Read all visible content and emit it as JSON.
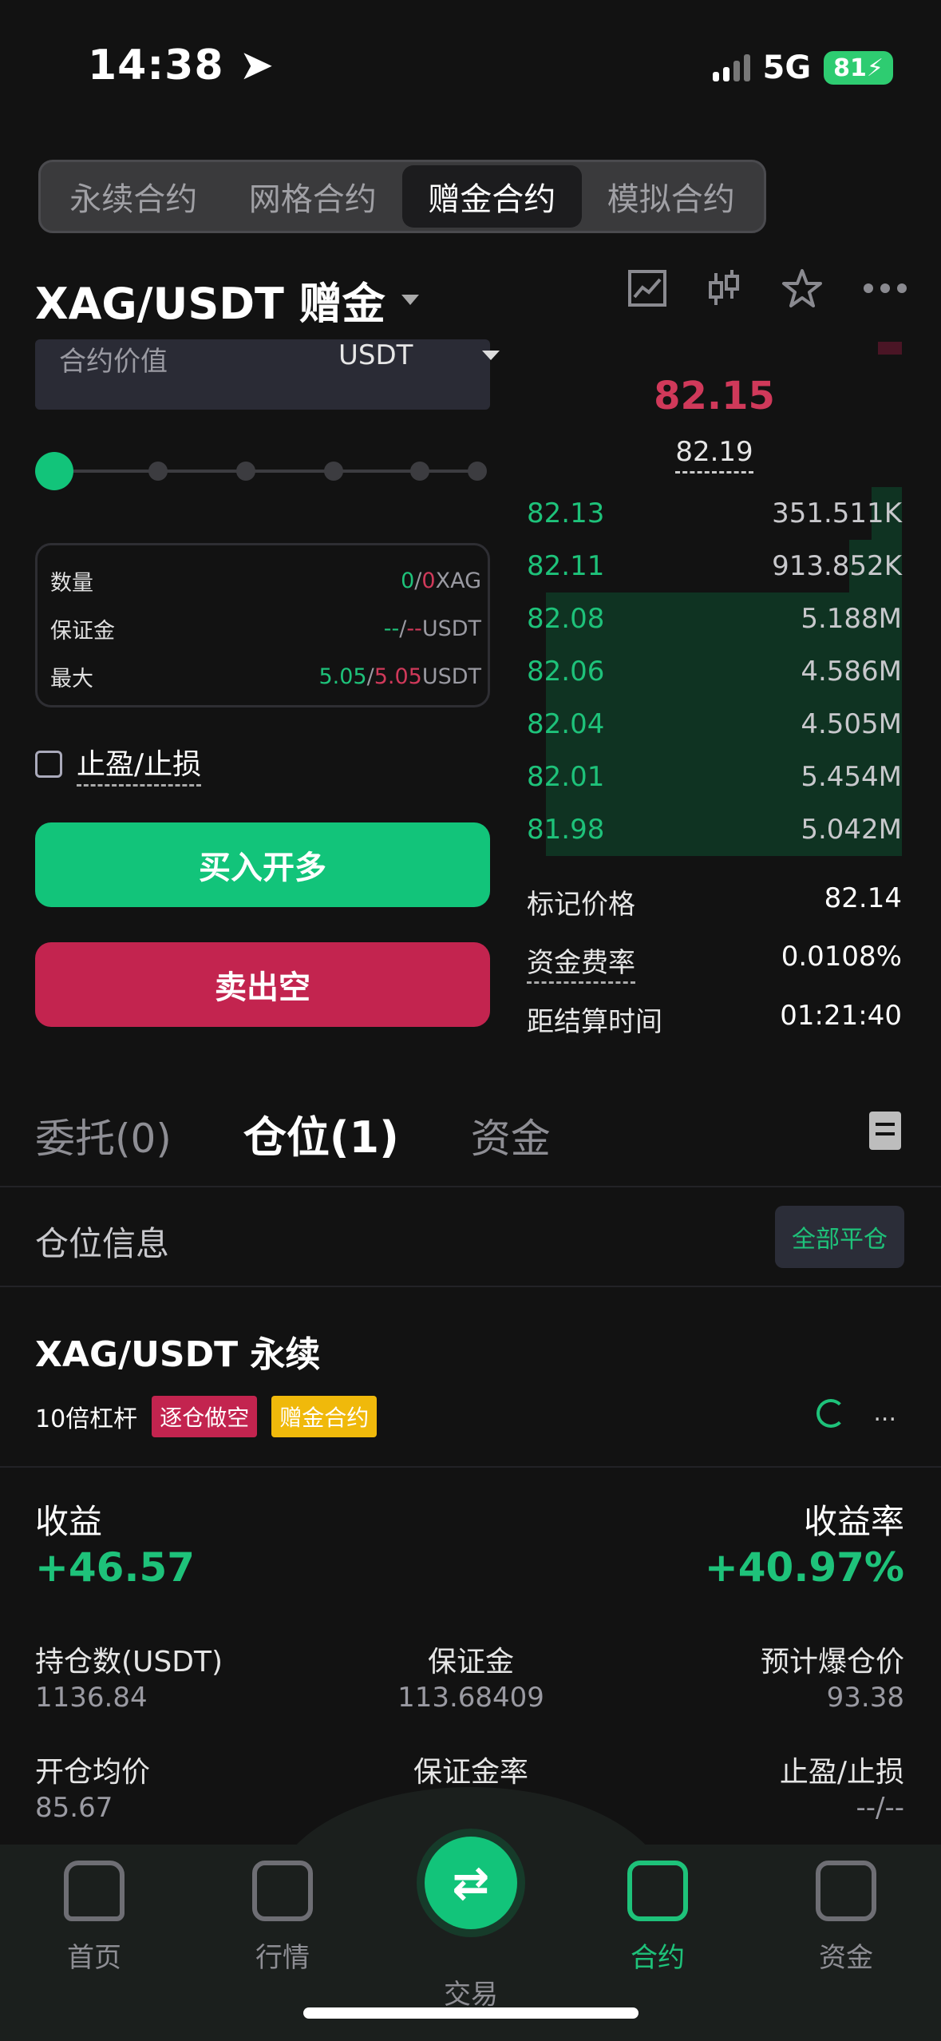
{
  "status": {
    "time": "14:38",
    "network": "5G",
    "battery": "81"
  },
  "segment_tabs": [
    "永续合约",
    "网格合约",
    "赠金合约",
    "模拟合约"
  ],
  "pair": {
    "title": "XAG/USDT 赠金"
  },
  "order": {
    "value_label": "合约价值",
    "unit": "USDT",
    "qty_label": "数量",
    "qty_v1": "0",
    "qty_v2": "0",
    "qty_unit": "XAG",
    "margin_label": "保证金",
    "margin_v1": "--",
    "margin_v2": "--",
    "margin_unit": "USDT",
    "max_label": "最大",
    "max_v1": "5.05",
    "max_v2": "5.05",
    "max_unit": "USDT",
    "tp_sl": "止盈/止损",
    "buy": "买入开多",
    "sell": "卖出空"
  },
  "orderbook": {
    "last_price": "82.15",
    "mark_small": "82.19",
    "bids": [
      {
        "price": "82.13",
        "qty": "351.511K",
        "depth": 0.08
      },
      {
        "price": "82.11",
        "qty": "913.852K",
        "depth": 0.14
      },
      {
        "price": "82.08",
        "qty": "5.188M",
        "depth": 0.95
      },
      {
        "price": "82.06",
        "qty": "4.586M",
        "depth": 0.95
      },
      {
        "price": "82.04",
        "qty": "4.505M",
        "depth": 0.95
      },
      {
        "price": "82.01",
        "qty": "5.454M",
        "depth": 0.95
      },
      {
        "price": "81.98",
        "qty": "5.042M",
        "depth": 0.95
      }
    ],
    "mark_label": "标记价格",
    "mark_value": "82.14",
    "funding_label": "资金费率",
    "funding_value": "0.0108%",
    "settle_label": "距结算时间",
    "settle_value": "01:21:40"
  },
  "tabs": {
    "orders": "委托(0)",
    "positions": "仓位(1)",
    "funds": "资金"
  },
  "position": {
    "info_label": "仓位信息",
    "close_all": "全部平仓",
    "pair": "XAG/USDT 永续",
    "leverage": "10倍杠杆",
    "tag_side": "逐仓做空",
    "tag_type": "赠金合约",
    "more": "...",
    "pnl_label": "收益",
    "pnl_value": "+46.57",
    "roi_label": "收益率",
    "roi_value": "+40.97%",
    "size_label": "持仓数(USDT)",
    "size_value": "1136.84",
    "margin_label": "保证金",
    "margin_value": "113.68409",
    "liq_label": "预计爆仓价",
    "liq_value": "93.38",
    "entry_label": "开仓均价",
    "entry_value": "85.67",
    "margin_rate_label": "保证金率",
    "tpsl_label": "止盈/止损",
    "tpsl_value": "--/--"
  },
  "nav": {
    "home": "首页",
    "market": "行情",
    "trade": "交易",
    "contract": "合约",
    "assets": "资金"
  },
  "colors": {
    "green": "#12c47a",
    "red": "#c3244f",
    "bg": "#121212"
  }
}
